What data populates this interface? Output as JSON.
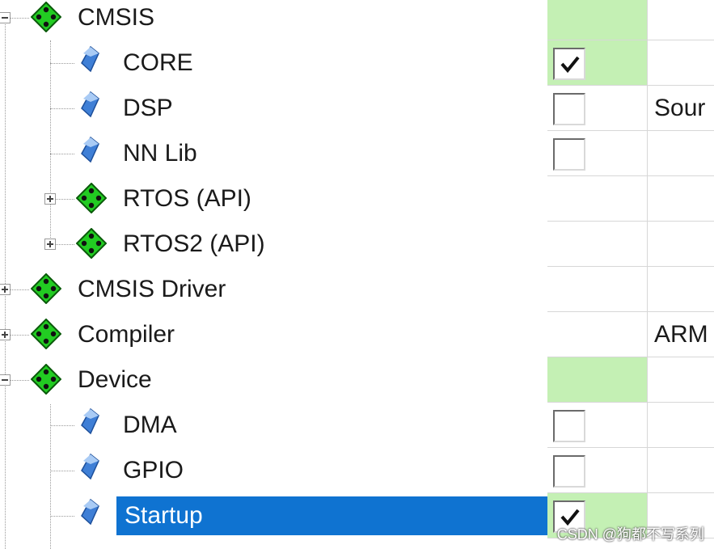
{
  "tree": {
    "rows": [
      {
        "label": "CMSIS",
        "kind": "group",
        "expander": "collapse",
        "level": 0
      },
      {
        "label": "CORE",
        "kind": "item",
        "level": 1
      },
      {
        "label": "DSP",
        "kind": "item",
        "level": 1
      },
      {
        "label": "NN Lib",
        "kind": "item",
        "level": 1
      },
      {
        "label": "RTOS (API)",
        "kind": "group",
        "expander": "expand",
        "level": 1
      },
      {
        "label": "RTOS2 (API)",
        "kind": "group",
        "expander": "expand",
        "level": 1
      },
      {
        "label": "CMSIS Driver",
        "kind": "group",
        "expander": "expand",
        "level": 0
      },
      {
        "label": "Compiler",
        "kind": "group",
        "expander": "expand",
        "level": 0
      },
      {
        "label": "Device",
        "kind": "group",
        "expander": "collapse",
        "level": 0
      },
      {
        "label": "DMA",
        "kind": "item",
        "level": 1
      },
      {
        "label": "GPIO",
        "kind": "item",
        "level": 1
      },
      {
        "label": "Startup",
        "kind": "item",
        "level": 1,
        "selected": true
      }
    ]
  },
  "grid": {
    "rows": [
      {
        "sel": "green",
        "checkbox": null,
        "c2": ""
      },
      {
        "sel": "green",
        "checkbox": true,
        "c2": ""
      },
      {
        "sel": "",
        "checkbox": false,
        "c2": "Sour"
      },
      {
        "sel": "",
        "checkbox": false,
        "c2": ""
      },
      {
        "sel": "",
        "checkbox": null,
        "c2": ""
      },
      {
        "sel": "",
        "checkbox": null,
        "c2": ""
      },
      {
        "sel": "",
        "checkbox": null,
        "c2": ""
      },
      {
        "sel": "",
        "checkbox": null,
        "c2": "ARM"
      },
      {
        "sel": "green",
        "checkbox": null,
        "c2": ""
      },
      {
        "sel": "",
        "checkbox": false,
        "c2": ""
      },
      {
        "sel": "",
        "checkbox": false,
        "c2": ""
      },
      {
        "sel": "green",
        "checkbox": true,
        "c2": ""
      }
    ]
  },
  "icons": {
    "group": "green-diamond-icon",
    "item": "blue-component-icon",
    "expand": "plus-icon",
    "collapse": "minus-icon",
    "check": "checkmark-icon"
  },
  "colors": {
    "selection": "#0f73d1",
    "green_cell": "#c4f0b4",
    "group_icon": "#22cc22",
    "item_icon": "#3f7fd6"
  },
  "watermark": "CSDN @狗都不写系列"
}
